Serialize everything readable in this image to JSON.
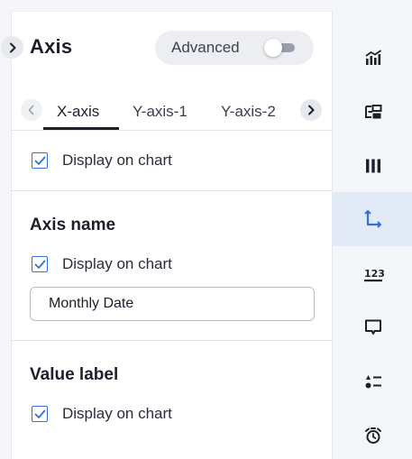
{
  "header": {
    "title": "Axis",
    "advanced_label": "Advanced",
    "advanced_enabled": false
  },
  "tabs": {
    "items": [
      {
        "label": "X-axis",
        "active": true
      },
      {
        "label": "Y-axis-1",
        "active": false
      },
      {
        "label": "Y-axis-2",
        "active": false
      }
    ]
  },
  "axis_display": {
    "label": "Display on chart",
    "checked": true
  },
  "axis_name": {
    "title": "Axis name",
    "display_label": "Display on chart",
    "checked": true,
    "input_value": "Monthly Date"
  },
  "value_label": {
    "title": "Value label",
    "display_label": "Display on chart",
    "checked": true
  },
  "rail": {
    "items": [
      {
        "icon": "chart-type-icon",
        "active": false
      },
      {
        "icon": "data-source-icon",
        "active": false
      },
      {
        "icon": "columns-icon",
        "active": false
      },
      {
        "icon": "axis-icon",
        "active": true
      },
      {
        "icon": "number-format-icon",
        "active": false
      },
      {
        "icon": "tooltip-icon",
        "active": false
      },
      {
        "icon": "legend-icon",
        "active": false
      },
      {
        "icon": "alarm-icon",
        "active": false
      }
    ]
  },
  "colors": {
    "accent": "#2f6fe0",
    "active_rail_bg": "#e3eaf7",
    "text": "#1d1f2b"
  }
}
